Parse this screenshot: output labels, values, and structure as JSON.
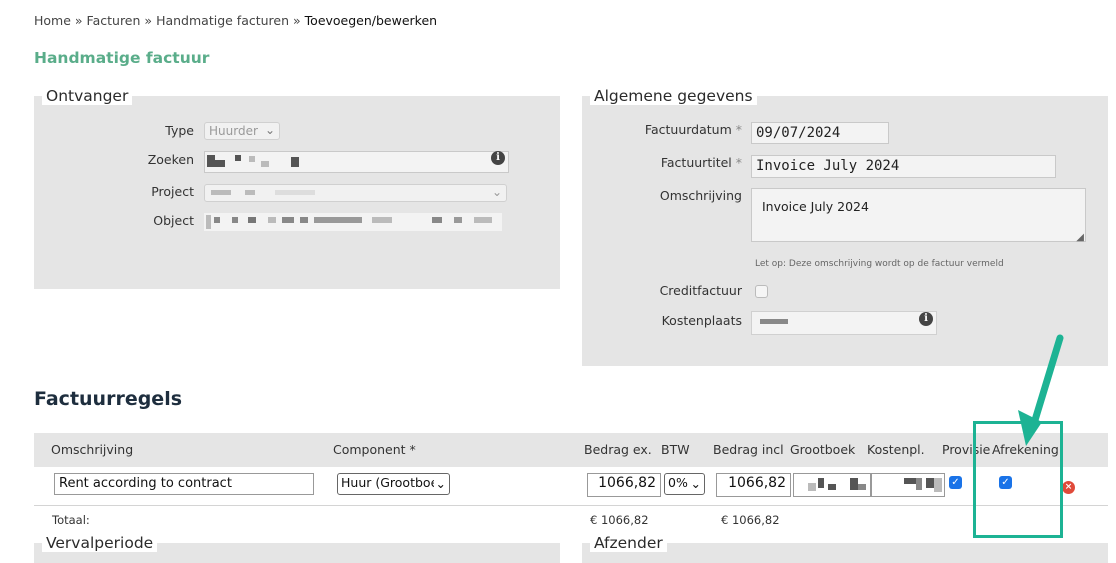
{
  "breadcrumb": {
    "items": [
      "Home",
      "Facturen",
      "Handmatige facturen"
    ],
    "separator": "»",
    "current": "Toevoegen/bewerken"
  },
  "page_title": "Handmatige factuur",
  "recipient": {
    "legend": "Ontvanger",
    "type_label": "Type",
    "type_value": "Huurder",
    "search_label": "Zoeken",
    "project_label": "Project",
    "object_label": "Object"
  },
  "general": {
    "legend": "Algemene gegevens",
    "date_label": "Factuurdatum",
    "date_value": "09/07/2024",
    "title_label": "Factuurtitel",
    "title_value": "Invoice July 2024",
    "description_label": "Omschrijving",
    "description_value": "Invoice July 2024",
    "note": "Let op: Deze omschrijving wordt op de factuur vermeld",
    "credit_label": "Creditfactuur",
    "costcenter_label": "Kostenplaats",
    "required_marker": "*"
  },
  "lines": {
    "heading": "Factuurregels",
    "columns": {
      "description": "Omschrijving",
      "component": "Component *",
      "amount_ex": "Bedrag ex.",
      "vat": "BTW",
      "amount_incl": "Bedrag incl",
      "ledger": "Grootboek",
      "costcenter": "Kostenpl.",
      "commission": "Provisie",
      "settlement": "Afrekening"
    },
    "row": {
      "description": "Rent according to contract",
      "component": "Huur (Grootboe",
      "amount_ex": "1066,82",
      "vat": "0%",
      "amount_incl": "1066,82",
      "commission_checked": true,
      "settlement_checked": true
    },
    "total_label": "Totaal:",
    "total_ex": "€ 1066,82",
    "total_incl": "€ 1066,82"
  },
  "bottom": {
    "expiry_legend": "Vervalperiode",
    "sender_legend": "Afzender"
  },
  "colors": {
    "accent_green": "#5aad8a",
    "annotation_teal": "#1db394",
    "checkbox_blue": "#1a73e8",
    "remove_red": "#e04a3a"
  }
}
